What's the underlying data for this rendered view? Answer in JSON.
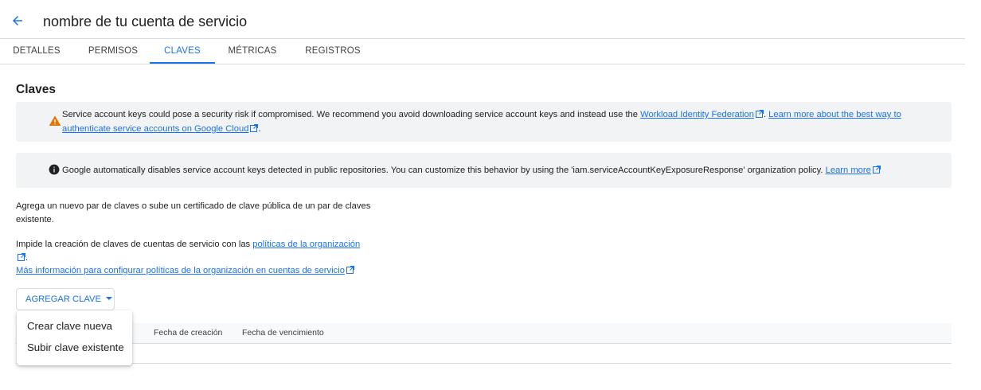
{
  "header": {
    "title": "nombre de tu cuenta de servicio",
    "back_icon": "arrow-back-icon"
  },
  "tabs": [
    {
      "label": "DETALLES",
      "active": false
    },
    {
      "label": "PERMISOS",
      "active": false
    },
    {
      "label": "CLAVES",
      "active": true
    },
    {
      "label": "MÉTRICAS",
      "active": false
    },
    {
      "label": "REGISTROS",
      "active": false
    }
  ],
  "section": {
    "title": "Claves"
  },
  "warning_banner": {
    "icon": "warning-icon",
    "text_before": "Service account keys could pose a security risk if compromised. We recommend you avoid downloading service account keys and instead use the ",
    "link1": "Workload Identity Federation",
    "text_middle": ". ",
    "link2": "Learn more about the best way to authenticate service accounts on Google Cloud",
    "text_after": "."
  },
  "info_banner": {
    "icon": "info-icon",
    "text": "Google automatically disables service account keys detected in public repositories. You can customize this behavior by using the 'iam.serviceAccountKeyExposureResponse' organization policy. ",
    "link": "Learn more"
  },
  "description": {
    "p1": "Agrega un nuevo par de claves o sube un certificado de clave pública de un par de claves existente.",
    "p2_text": "Impide la creación de claves de cuentas de servicio con las ",
    "p2_link": "políticas de la organización",
    "p2_after": ".",
    "p3_link": "Más información para configurar políticas de la organización en cuentas de servicio"
  },
  "add_key_button": {
    "label": "AGREGAR CLAVE"
  },
  "table": {
    "columns": [
      "Fecha de creación",
      "Fecha de vencimiento"
    ]
  },
  "dropdown_menu": {
    "items": [
      "Crear clave nueva",
      "Subir clave existente"
    ]
  },
  "colors": {
    "accent": "#1a73e8",
    "warning": "#e37400",
    "banner_bg": "#f1f3f4"
  }
}
